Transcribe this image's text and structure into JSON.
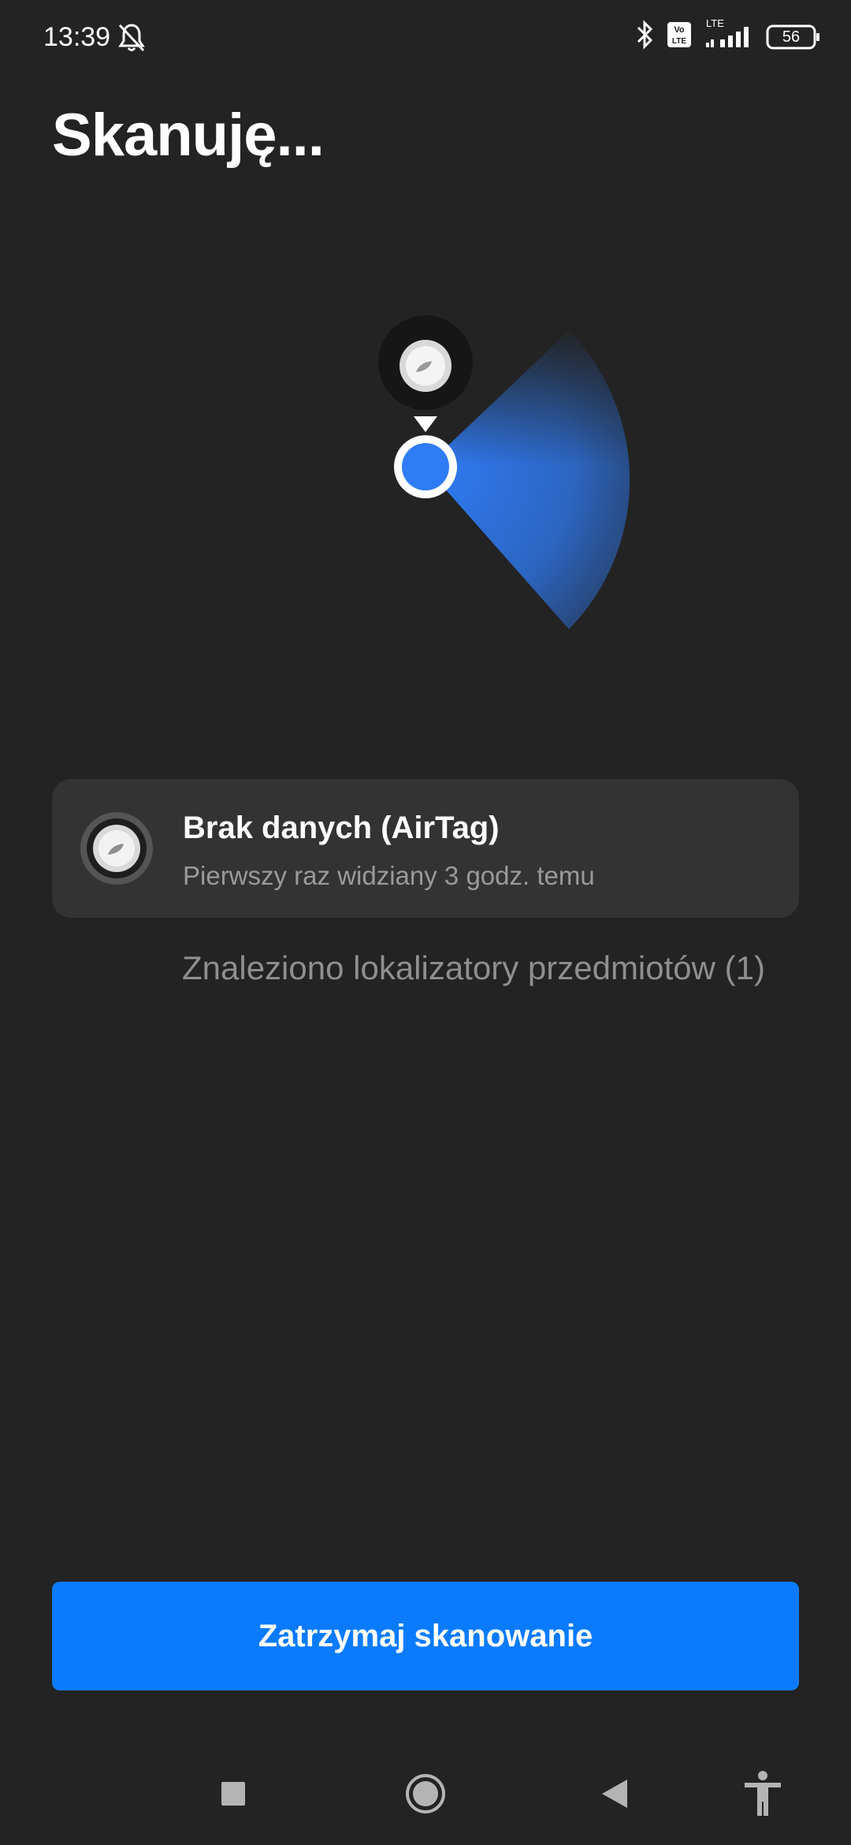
{
  "status_bar": {
    "time": "13:39",
    "icons": [
      "bell-off-icon",
      "bluetooth-icon",
      "volte-icon",
      "lte-signal-icon",
      "battery-icon"
    ],
    "network_label": "LTE",
    "volte_label": "Vo LTE",
    "battery_level": "56"
  },
  "header": {
    "title": "Skanuję..."
  },
  "radar": {
    "accent_color": "#2f7cf6",
    "icons": [
      "airtag-icon",
      "location-dot-icon"
    ]
  },
  "device_card": {
    "name": "Brak danych (AirTag)",
    "first_seen": "Pierwszy raz widziany 3 godz. temu",
    "icon": "airtag-icon"
  },
  "found_text": "Znaleziono lokalizatory przedmiotów (1)",
  "stop_button": {
    "label": "Zatrzymaj skanowanie",
    "color": "#0a7bff"
  },
  "nav_bar": {
    "items": [
      "recents-square-icon",
      "home-circle-icon",
      "back-triangle-icon",
      "accessibility-icon"
    ]
  }
}
